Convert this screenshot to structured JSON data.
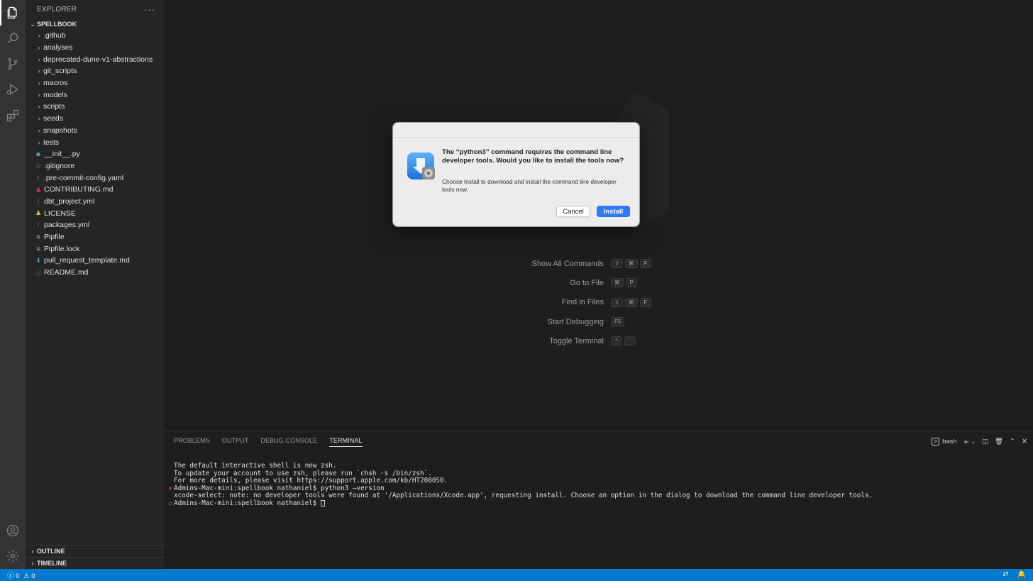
{
  "sidebar": {
    "header": "EXPLORER",
    "more": "···",
    "project": "SPELLBOOK",
    "folders": [
      ".github",
      "analyses",
      "deprecated-dune-v1-abstractions",
      "git_scripts",
      "macros",
      "models",
      "scripts",
      "seeds",
      "snapshots",
      "tests"
    ],
    "files": [
      {
        "name": "__init__.py",
        "icon": "python-icon",
        "glyph": "◆",
        "color": "#519aba"
      },
      {
        "name": ".gitignore",
        "icon": "git-icon",
        "glyph": "◇",
        "color": "#6d8086"
      },
      {
        "name": ".pre-commit-config.yaml",
        "icon": "yaml-icon",
        "glyph": "!",
        "color": "#a074c4"
      },
      {
        "name": "CONTRIBUTING.md",
        "icon": "contributing-icon",
        "glyph": "♟",
        "color": "#cc3e44"
      },
      {
        "name": "dbt_project.yml",
        "icon": "yaml-icon",
        "glyph": "!",
        "color": "#a074c4"
      },
      {
        "name": "LICENSE",
        "icon": "license-icon",
        "glyph": "♟",
        "color": "#cbcb41"
      },
      {
        "name": "packages.yml",
        "icon": "yaml-icon",
        "glyph": "!",
        "color": "#a074c4"
      },
      {
        "name": "Pipfile",
        "icon": "text-icon",
        "glyph": "≡",
        "color": "#cccccc"
      },
      {
        "name": "Pipfile.lock",
        "icon": "text-icon",
        "glyph": "≡",
        "color": "#cccccc"
      },
      {
        "name": "pull_request_template.md",
        "icon": "markdown-download-icon",
        "glyph": "⬇",
        "color": "#519aba"
      },
      {
        "name": "README.md",
        "icon": "info-icon",
        "glyph": "ⓘ",
        "color": "#519aba"
      }
    ],
    "outline": "OUTLINE",
    "timeline": "TIMELINE"
  },
  "shortcuts": [
    {
      "label": "Show All Commands",
      "keys": [
        "⇧",
        "⌘",
        "P"
      ]
    },
    {
      "label": "Go to File",
      "keys": [
        "⌘",
        "P"
      ]
    },
    {
      "label": "Find in Files",
      "keys": [
        "⇧",
        "⌘",
        "F"
      ]
    },
    {
      "label": "Start Debugging",
      "keys": [
        "F5"
      ]
    },
    {
      "label": "Toggle Terminal",
      "keys": [
        "^",
        "`"
      ]
    }
  ],
  "dialog": {
    "title": "The “python3” command requires the command line developer tools. Would you like to install the tools now?",
    "message": "Choose Install to download and install the command line developer tools now.",
    "cancel_label": "Cancel",
    "install_label": "Install"
  },
  "panel": {
    "tabs": [
      "PROBLEMS",
      "OUTPUT",
      "DEBUG CONSOLE",
      "TERMINAL"
    ],
    "active_tab": "TERMINAL",
    "shell": "bash",
    "terminal_lines": [
      {
        "marker": "",
        "text": "The default interactive shell is now zsh."
      },
      {
        "marker": "",
        "text": "To update your account to use zsh, please run `chsh -s /bin/zsh`."
      },
      {
        "marker": "",
        "text": "For more details, please visit https://support.apple.com/kb/HT208050."
      },
      {
        "marker": "error",
        "text": "Admins-Mac-mini:spellbook nathaniel$ python3 —version"
      },
      {
        "marker": "",
        "text": "xcode-select: note: no developer tools were found at '/Applications/Xcode.app', requesting install. Choose an option in the dialog to download the command line developer tools."
      },
      {
        "marker": "empty",
        "text": "Admins-Mac-mini:spellbook nathaniel$ "
      }
    ]
  },
  "status": {
    "errors": "0",
    "warnings": "0"
  },
  "colors": {
    "accent": "#007acc",
    "install_button": "#2f7cf6",
    "error_marker": "#f14c4c"
  }
}
